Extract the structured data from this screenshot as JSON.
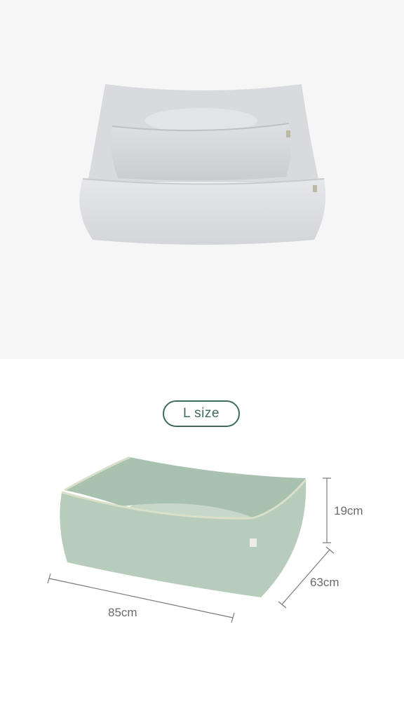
{
  "top_image": {
    "alt": "bed-stack",
    "colors": {
      "background": "#f6f6f6",
      "bed": "#dcdde0"
    }
  },
  "bottom_image": {
    "size_badge": "L size",
    "dimensions": {
      "height": "19cm",
      "depth": "63cm",
      "width": "85cm"
    },
    "colors": {
      "accent": "#3f6b5d",
      "bed": "#b7cbbb",
      "piping": "#d9dfc9"
    }
  }
}
